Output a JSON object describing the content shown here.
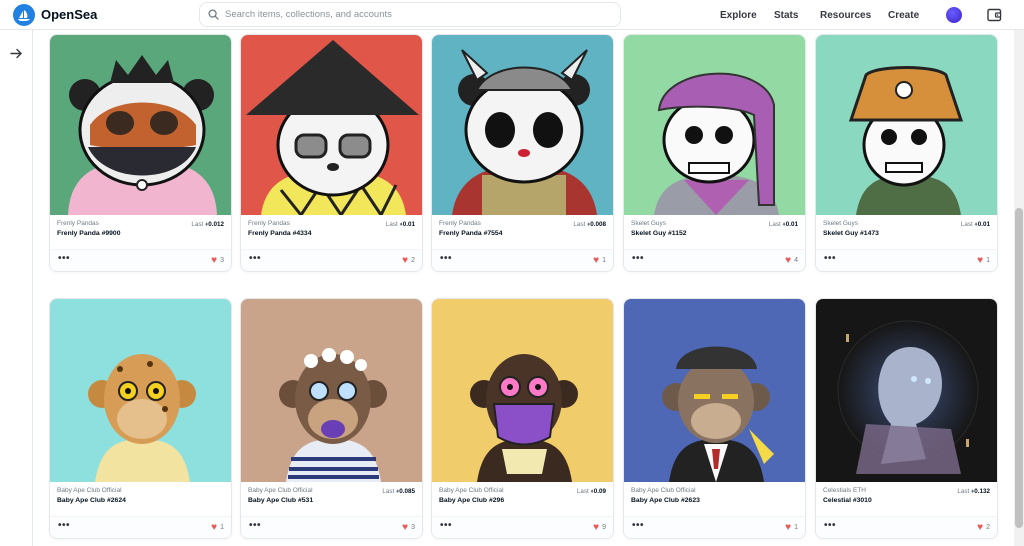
{
  "header": {
    "brand": "OpenSea",
    "search_placeholder": "Search items, collections, and accounts",
    "nav": [
      "Explore",
      "Stats",
      "Resources",
      "Create"
    ]
  },
  "colors": {
    "accent": "#2081e2",
    "heart": "#eb5757"
  },
  "cards": [
    {
      "collection": "Frenly Pandas",
      "name": "Frenly Panda #9900",
      "last_label": "Last",
      "price": "0.012",
      "favorites": "3",
      "bg": "#5aa77c"
    },
    {
      "collection": "Frenly Pandas",
      "name": "Frenly Panda #4334",
      "last_label": "Last",
      "price": "0.01",
      "favorites": "2",
      "bg": "#e0574a"
    },
    {
      "collection": "Frenly Pandas",
      "name": "Frenly Panda #7554",
      "last_label": "Last",
      "price": "0.008",
      "favorites": "1",
      "bg": "#5fb3c2"
    },
    {
      "collection": "Skelet Guys",
      "name": "Skelet Guy #1152",
      "last_label": "Last",
      "price": "0.01",
      "favorites": "4",
      "bg": "#93d9a3"
    },
    {
      "collection": "Skelet Guys",
      "name": "Skelet Guy #1473",
      "last_label": "Last",
      "price": "0.01",
      "favorites": "1",
      "bg": "#8ad8c0"
    },
    {
      "collection": "Baby Ape Club Official",
      "name": "Baby Ape Club #2624",
      "last_label": "",
      "price": "",
      "favorites": "1",
      "bg": "#8de0de"
    },
    {
      "collection": "Baby Ape Club Official",
      "name": "Baby Ape Club #531",
      "last_label": "Last",
      "price": "0.085",
      "favorites": "3",
      "bg": "#c9a48a"
    },
    {
      "collection": "Baby Ape Club Official",
      "name": "Baby Ape Club #296",
      "last_label": "Last",
      "price": "0.09",
      "favorites": "9",
      "bg": "#f0cd6a"
    },
    {
      "collection": "Baby Ape Club Official",
      "name": "Baby Ape Club #2623",
      "last_label": "",
      "price": "",
      "favorites": "1",
      "bg": "#4e68b6"
    },
    {
      "collection": "Celestials ETH",
      "name": "Celestial #3010",
      "last_label": "Last",
      "price": "0.132",
      "favorites": "2",
      "bg": "#161616"
    }
  ],
  "more_label": "•••",
  "icons": [
    "opensea-logo-icon",
    "search-icon",
    "wallet-icon",
    "arrow-right-icon",
    "ethereum-icon",
    "heart-icon"
  ]
}
